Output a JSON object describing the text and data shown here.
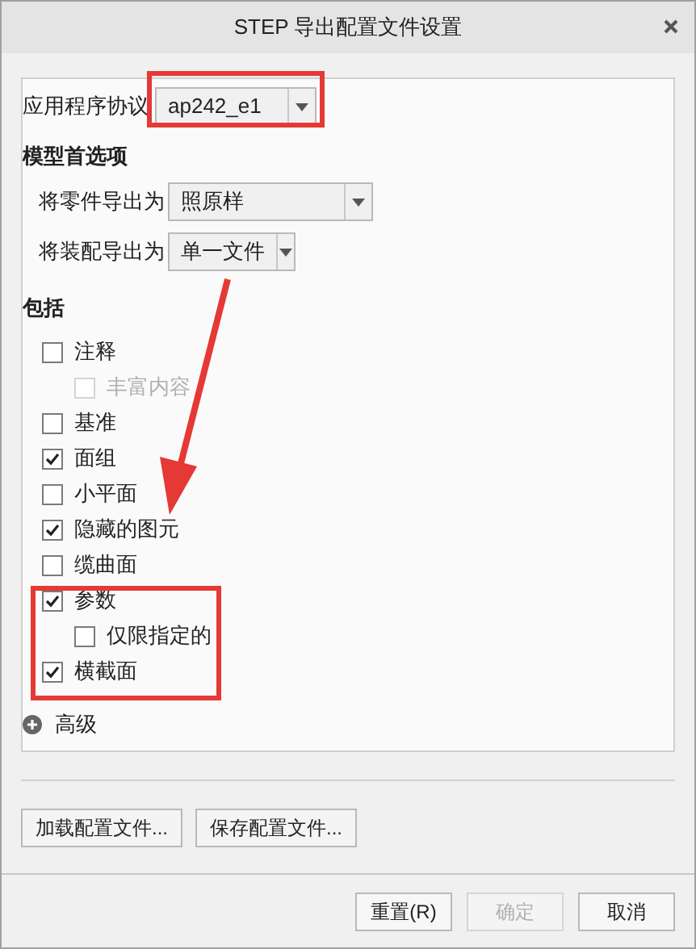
{
  "window": {
    "title": "STEP 导出配置文件设置"
  },
  "protocol": {
    "label": "应用程序协议",
    "value": "ap242_e1"
  },
  "model_prefs": {
    "title": "模型首选项",
    "fields": [
      {
        "label": "将零件导出为",
        "value": "照原样"
      },
      {
        "label": "将装配导出为",
        "value": "单一文件"
      }
    ]
  },
  "include": {
    "title": "包括",
    "items": [
      {
        "label": "注释",
        "checked": false,
        "disabled": false,
        "children": [
          {
            "label": "丰富内容",
            "checked": false,
            "disabled": true
          }
        ]
      },
      {
        "label": "基准",
        "checked": false,
        "disabled": false
      },
      {
        "label": "面组",
        "checked": true,
        "disabled": false
      },
      {
        "label": "小平面",
        "checked": false,
        "disabled": false
      },
      {
        "label": "隐藏的图元",
        "checked": true,
        "disabled": false
      },
      {
        "label": "缆曲面",
        "checked": false,
        "disabled": false
      },
      {
        "label": "参数",
        "checked": true,
        "disabled": false,
        "children": [
          {
            "label": "仅限指定的",
            "checked": false,
            "disabled": false
          }
        ]
      },
      {
        "label": "横截面",
        "checked": true,
        "disabled": false
      }
    ]
  },
  "advanced": {
    "label": "高级",
    "expanded": false
  },
  "profile_buttons": [
    "加载配置文件...",
    "保存配置文件..."
  ],
  "footer_buttons": [
    {
      "label": "重置(R)",
      "disabled": false
    },
    {
      "label": "确定",
      "disabled": true
    },
    {
      "label": "取消",
      "disabled": false
    }
  ]
}
